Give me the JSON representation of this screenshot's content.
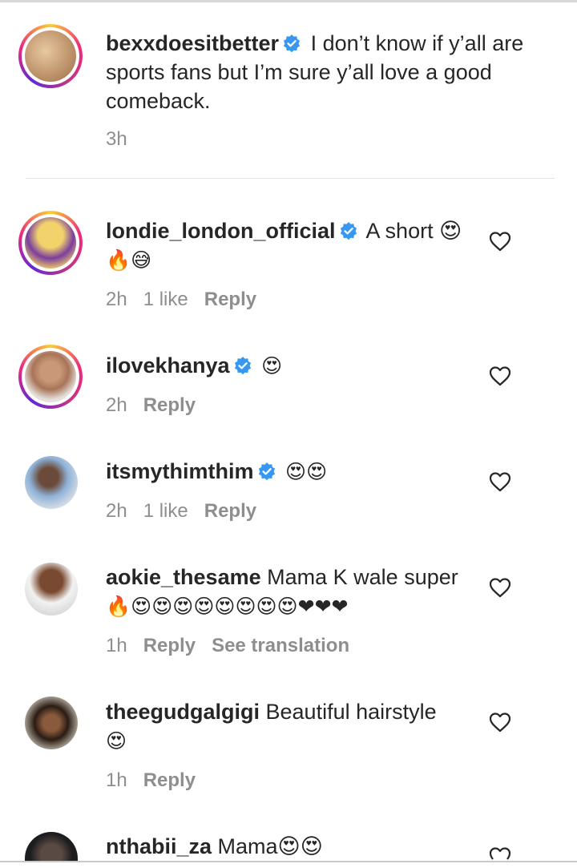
{
  "post": {
    "username": "bexxdoesitbetter",
    "text": "I don’t know if y’all are sports fans but I’m sure y’all love a good comeback.",
    "time": "3h"
  },
  "comments": [
    {
      "username": "londie_london_official",
      "text": "A short 😍",
      "line2": "🔥😅",
      "time": "2h",
      "likes": "1 like",
      "reply": "Reply"
    },
    {
      "username": "ilovekhanya",
      "text": "😍",
      "time": "2h",
      "reply": "Reply"
    },
    {
      "username": "itsmythimthim",
      "text": "😍😍",
      "time": "2h",
      "likes": "1 like",
      "reply": "Reply"
    },
    {
      "username": "aokie_thesame",
      "text": "Mama K wale super",
      "line2": "🔥😍😍😍😍😍😍😍😍❤❤❤",
      "time": "1h",
      "reply": "Reply",
      "translate": "See translation"
    },
    {
      "username": "theegudgalgigi",
      "text": "Beautiful hairstyle",
      "line2": "😍",
      "time": "1h",
      "reply": "Reply"
    },
    {
      "username": "nthabii_za",
      "text": "Mama😍😍"
    }
  ],
  "colors": {
    "verified": "#3897f0",
    "meta": "#8e8e8e",
    "text": "#262626"
  }
}
